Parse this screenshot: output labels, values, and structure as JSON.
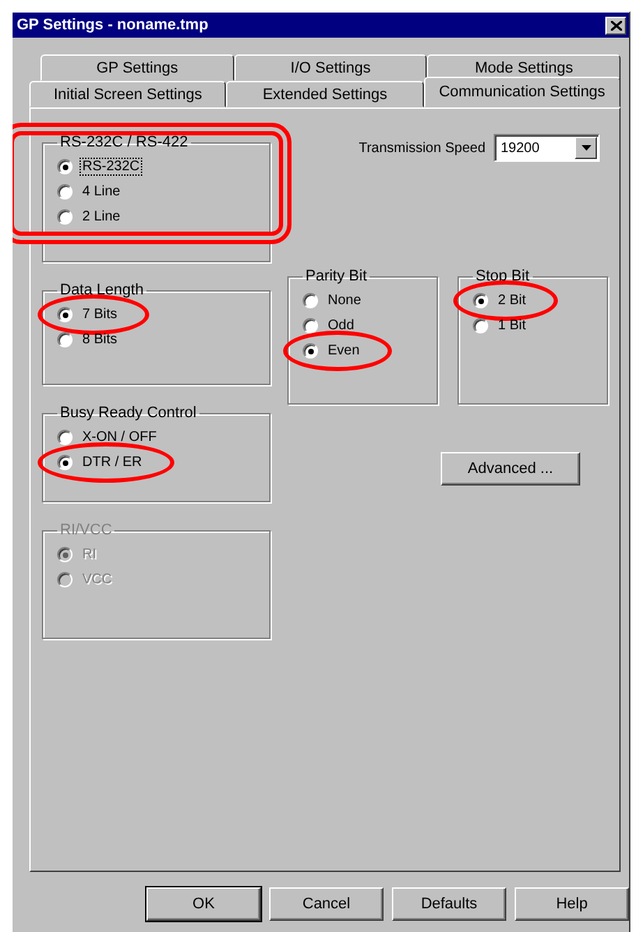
{
  "window": {
    "title": "GP Settings - noname.tmp"
  },
  "tab_rows": [
    [
      {
        "label": "GP Settings",
        "selected": false
      },
      {
        "label": "I/O Settings",
        "selected": false
      },
      {
        "label": "Mode Settings",
        "selected": false
      }
    ],
    [
      {
        "label": "Initial Screen Settings",
        "selected": false
      },
      {
        "label": "Extended Settings",
        "selected": false
      },
      {
        "label": "Communication Settings",
        "selected": true
      }
    ]
  ],
  "port_group": {
    "title": "RS-232C / RS-422",
    "disabled": false,
    "highlighted": true,
    "options": [
      {
        "label": "RS-232C",
        "selected": true,
        "circled": false,
        "focused": true
      },
      {
        "label": "4 Line",
        "selected": false,
        "circled": false,
        "focused": false
      },
      {
        "label": "2 Line",
        "selected": false,
        "circled": false,
        "focused": false
      }
    ]
  },
  "transmission_speed": {
    "label": "Transmission Speed",
    "value": "19200"
  },
  "data_length": {
    "title": "Data Length",
    "disabled": false,
    "highlighted": false,
    "options": [
      {
        "label": "7 Bits",
        "selected": true,
        "circled": true,
        "focused": false
      },
      {
        "label": "8 Bits",
        "selected": false,
        "circled": false,
        "focused": false
      }
    ]
  },
  "parity_bit": {
    "title": "Parity Bit",
    "disabled": false,
    "highlighted": false,
    "options": [
      {
        "label": "None",
        "selected": false,
        "circled": false,
        "focused": false
      },
      {
        "label": "Odd",
        "selected": false,
        "circled": false,
        "focused": false
      },
      {
        "label": "Even",
        "selected": true,
        "circled": true,
        "focused": false
      }
    ]
  },
  "stop_bit": {
    "title": "Stop Bit",
    "disabled": false,
    "highlighted": false,
    "options": [
      {
        "label": "2 Bit",
        "selected": true,
        "circled": true,
        "focused": false
      },
      {
        "label": "1 Bit",
        "selected": false,
        "circled": false,
        "focused": false
      }
    ]
  },
  "busy_ready_control": {
    "title": "Busy Ready Control",
    "disabled": false,
    "highlighted": false,
    "options": [
      {
        "label": "X-ON / OFF",
        "selected": false,
        "circled": false,
        "focused": false
      },
      {
        "label": "DTR / ER",
        "selected": true,
        "circled": true,
        "focused": false
      }
    ]
  },
  "advanced_button": {
    "label": "Advanced ..."
  },
  "ri_vcc": {
    "title": "RI/VCC",
    "disabled": true,
    "highlighted": false,
    "options": [
      {
        "label": "RI",
        "selected": true,
        "circled": false,
        "focused": false
      },
      {
        "label": "VCC",
        "selected": false,
        "circled": false,
        "focused": false
      }
    ]
  },
  "buttons": [
    {
      "label": "OK"
    },
    {
      "label": "Cancel"
    },
    {
      "label": "Defaults"
    },
    {
      "label": "Help"
    }
  ]
}
